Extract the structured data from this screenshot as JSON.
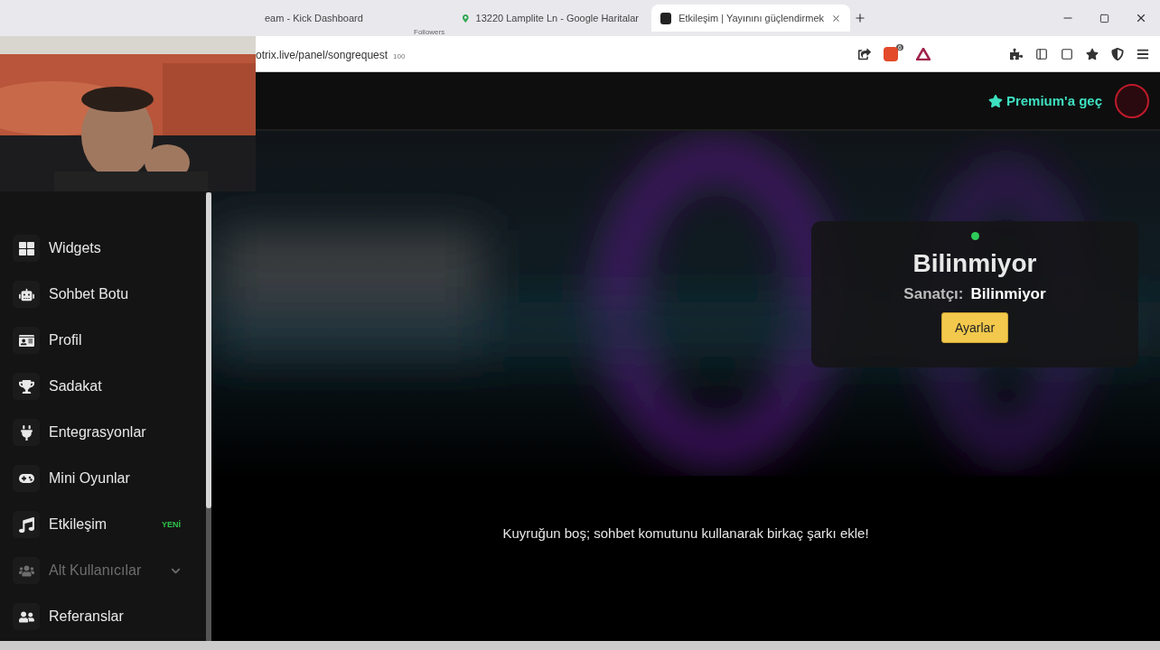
{
  "browser": {
    "tabs": [
      {
        "title": "eam - Kick Dashboard",
        "selected": false
      },
      {
        "title": "13220 Lamplite Ln - Google Haritalar",
        "selected": false
      },
      {
        "title": "Etkileşim | Yayınını güçlendirmek",
        "selected": true
      }
    ],
    "tab_note": "Followers",
    "url": "otrix.live/panel/songrequest",
    "url_note": "100",
    "shield_count": "6"
  },
  "header": {
    "premium": "Premium'a geç"
  },
  "sidebar": {
    "items": [
      {
        "label": "Widgets",
        "disabled": false
      },
      {
        "label": "Sohbet Botu",
        "disabled": false
      },
      {
        "label": "Profil",
        "disabled": false
      },
      {
        "label": "Sadakat",
        "disabled": false
      },
      {
        "label": "Entegrasyonlar",
        "disabled": false
      },
      {
        "label": "Mini Oyunlar",
        "disabled": false
      },
      {
        "label": "Etkileşim",
        "disabled": false,
        "badge": "YENİ"
      },
      {
        "label": "Alt Kullanıcılar",
        "disabled": true,
        "expanded": false
      },
      {
        "label": "Referanslar",
        "disabled": false
      }
    ]
  },
  "now_playing": {
    "online": true,
    "title": "Bilinmiyor",
    "artist_label": "Sanatçı:",
    "artist": "Bilinmiyor",
    "button": "Ayarlar"
  },
  "queue_message": "Kuyruğun boş; sohbet komutunu kullanarak birkaç şarkı ekle!"
}
